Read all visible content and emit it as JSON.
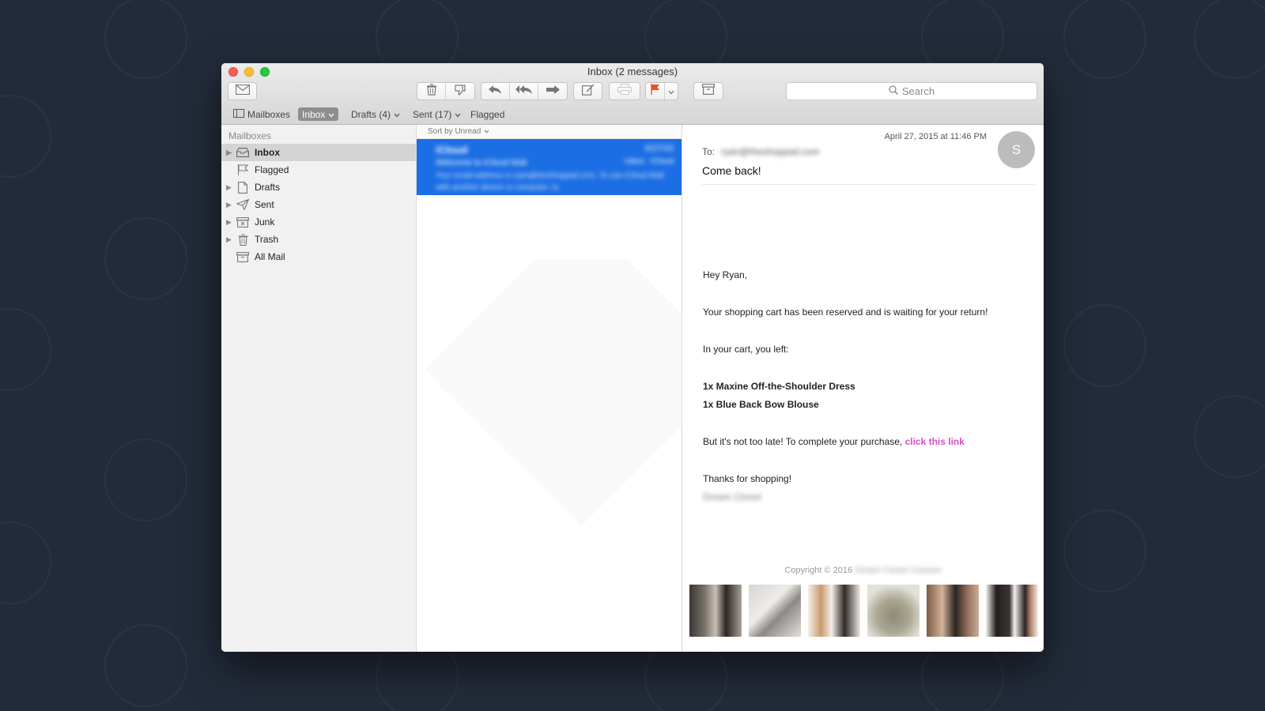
{
  "window": {
    "title": "Inbox (2 messages)"
  },
  "toolbar": {
    "search_placeholder": "Search",
    "flag_color": "#e8531e"
  },
  "favorites": {
    "mailboxes": "Mailboxes",
    "inbox": "Inbox",
    "drafts": "Drafts (4)",
    "sent": "Sent (17)",
    "flagged": "Flagged"
  },
  "sidebar": {
    "header": "Mailboxes",
    "items": [
      {
        "label": "Inbox",
        "icon": "inbox-icon"
      },
      {
        "label": "Flagged",
        "icon": "flag-icon"
      },
      {
        "label": "Drafts",
        "icon": "draft-icon"
      },
      {
        "label": "Sent",
        "icon": "sent-icon"
      },
      {
        "label": "Junk",
        "icon": "junk-icon"
      },
      {
        "label": "Trash",
        "icon": "trash-icon"
      },
      {
        "label": "All Mail",
        "icon": "archive-icon"
      }
    ]
  },
  "message_list": {
    "sort_label": "Sort by Unread",
    "selected_message": {
      "from": "iCloud",
      "date": "4/27/15",
      "subject": "Welcome to iCloud Mail",
      "mailbox": "Inbox - iCloud",
      "preview": "Your email address is ryan@theshoppad.com. To use iCloud Mail with another device or computer, tu"
    }
  },
  "reader": {
    "date": "April 27, 2015 at 11:46 PM",
    "avatar_initial": "S",
    "to_label": "To:",
    "to_value": "ryan@theshoppad.com",
    "subject": "Come back!",
    "greeting": "Hey Ryan,",
    "line1": "Your shopping cart has been reserved and is waiting for your return!",
    "line2": "In your cart, you left:",
    "item1": "1x Maxine Off-the-Shoulder Dress",
    "item2": "1x Blue Back Bow Blouse",
    "cta_text": "But it's not too late! To complete your purchase,",
    "cta_link": "click this link",
    "closing": "Thanks for shopping!",
    "signature": "Dream Closet",
    "copyright": "Copyright © 2016",
    "copyright_owner": "Dream Closet Couture",
    "link_color": "#d14fc4"
  },
  "colors": {
    "selection": "#1b6ee4",
    "desktop": "#232b3a"
  }
}
